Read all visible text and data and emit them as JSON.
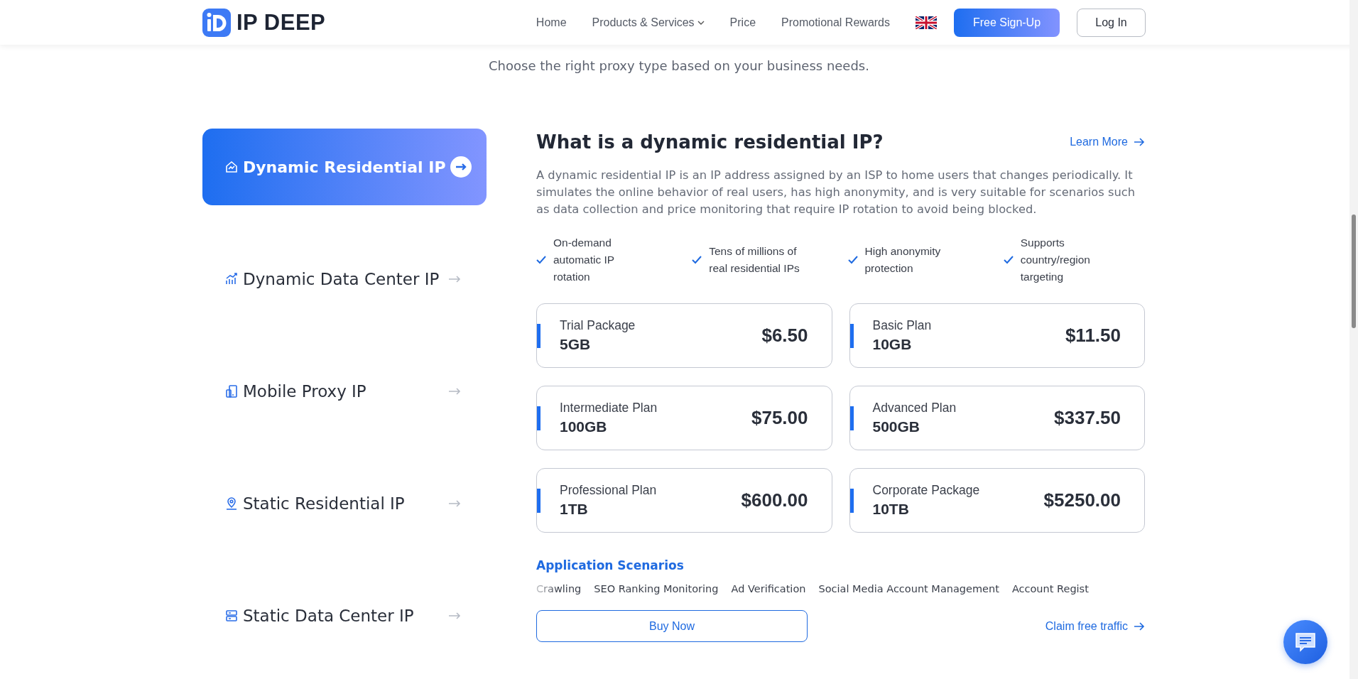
{
  "header": {
    "logo_text": "IP DEEP",
    "nav": [
      {
        "label": "Home",
        "kind": "link"
      },
      {
        "label": "Products & Services",
        "kind": "dropdown"
      },
      {
        "label": "Price",
        "kind": "link"
      },
      {
        "label": "Promotional Rewards",
        "kind": "link"
      }
    ],
    "signup": "Free Sign-Up",
    "login": "Log In"
  },
  "subtitle": "Choose the right proxy type based on your business needs.",
  "menu": [
    {
      "label": "Dynamic Residential IP",
      "selected": true
    },
    {
      "label": "Dynamic Data Center IP",
      "selected": false
    },
    {
      "label": "Mobile Proxy IP",
      "selected": false
    },
    {
      "label": "Static Residential IP",
      "selected": false
    },
    {
      "label": "Static Data Center IP",
      "selected": false
    }
  ],
  "detail": {
    "title": "What is a dynamic residential IP?",
    "learn_more": "Learn More",
    "description": "A dynamic residential IP is an IP address assigned by an ISP to home users that changes periodically. It simulates the online behavior of real users, has high anonymity, and is very suitable for scenarios such as data collection and price monitoring that require IP rotation to avoid being blocked.",
    "features": [
      "On-demand automatic IP rotation",
      "Tens of millions of real residential IPs",
      "High anonymity protection",
      "Supports country/region targeting"
    ],
    "plans": [
      {
        "name": "Trial Package",
        "amount": "5GB",
        "price": "$6.50"
      },
      {
        "name": "Basic Plan",
        "amount": "10GB",
        "price": "$11.50"
      },
      {
        "name": "Intermediate Plan",
        "amount": "100GB",
        "price": "$75.00"
      },
      {
        "name": "Advanced Plan",
        "amount": "500GB",
        "price": "$337.50"
      },
      {
        "name": "Professional Plan",
        "amount": "1TB",
        "price": "$600.00"
      },
      {
        "name": "Corporate Package",
        "amount": "10TB",
        "price": "$5250.00"
      }
    ],
    "scenarios_title": "Application Scenarios",
    "scenarios": [
      "Crawling",
      "SEO Ranking Monitoring",
      "Ad Verification",
      "Social Media Account Management",
      "Account Regist"
    ],
    "buy": "Buy Now",
    "claim": "Claim free traffic"
  }
}
